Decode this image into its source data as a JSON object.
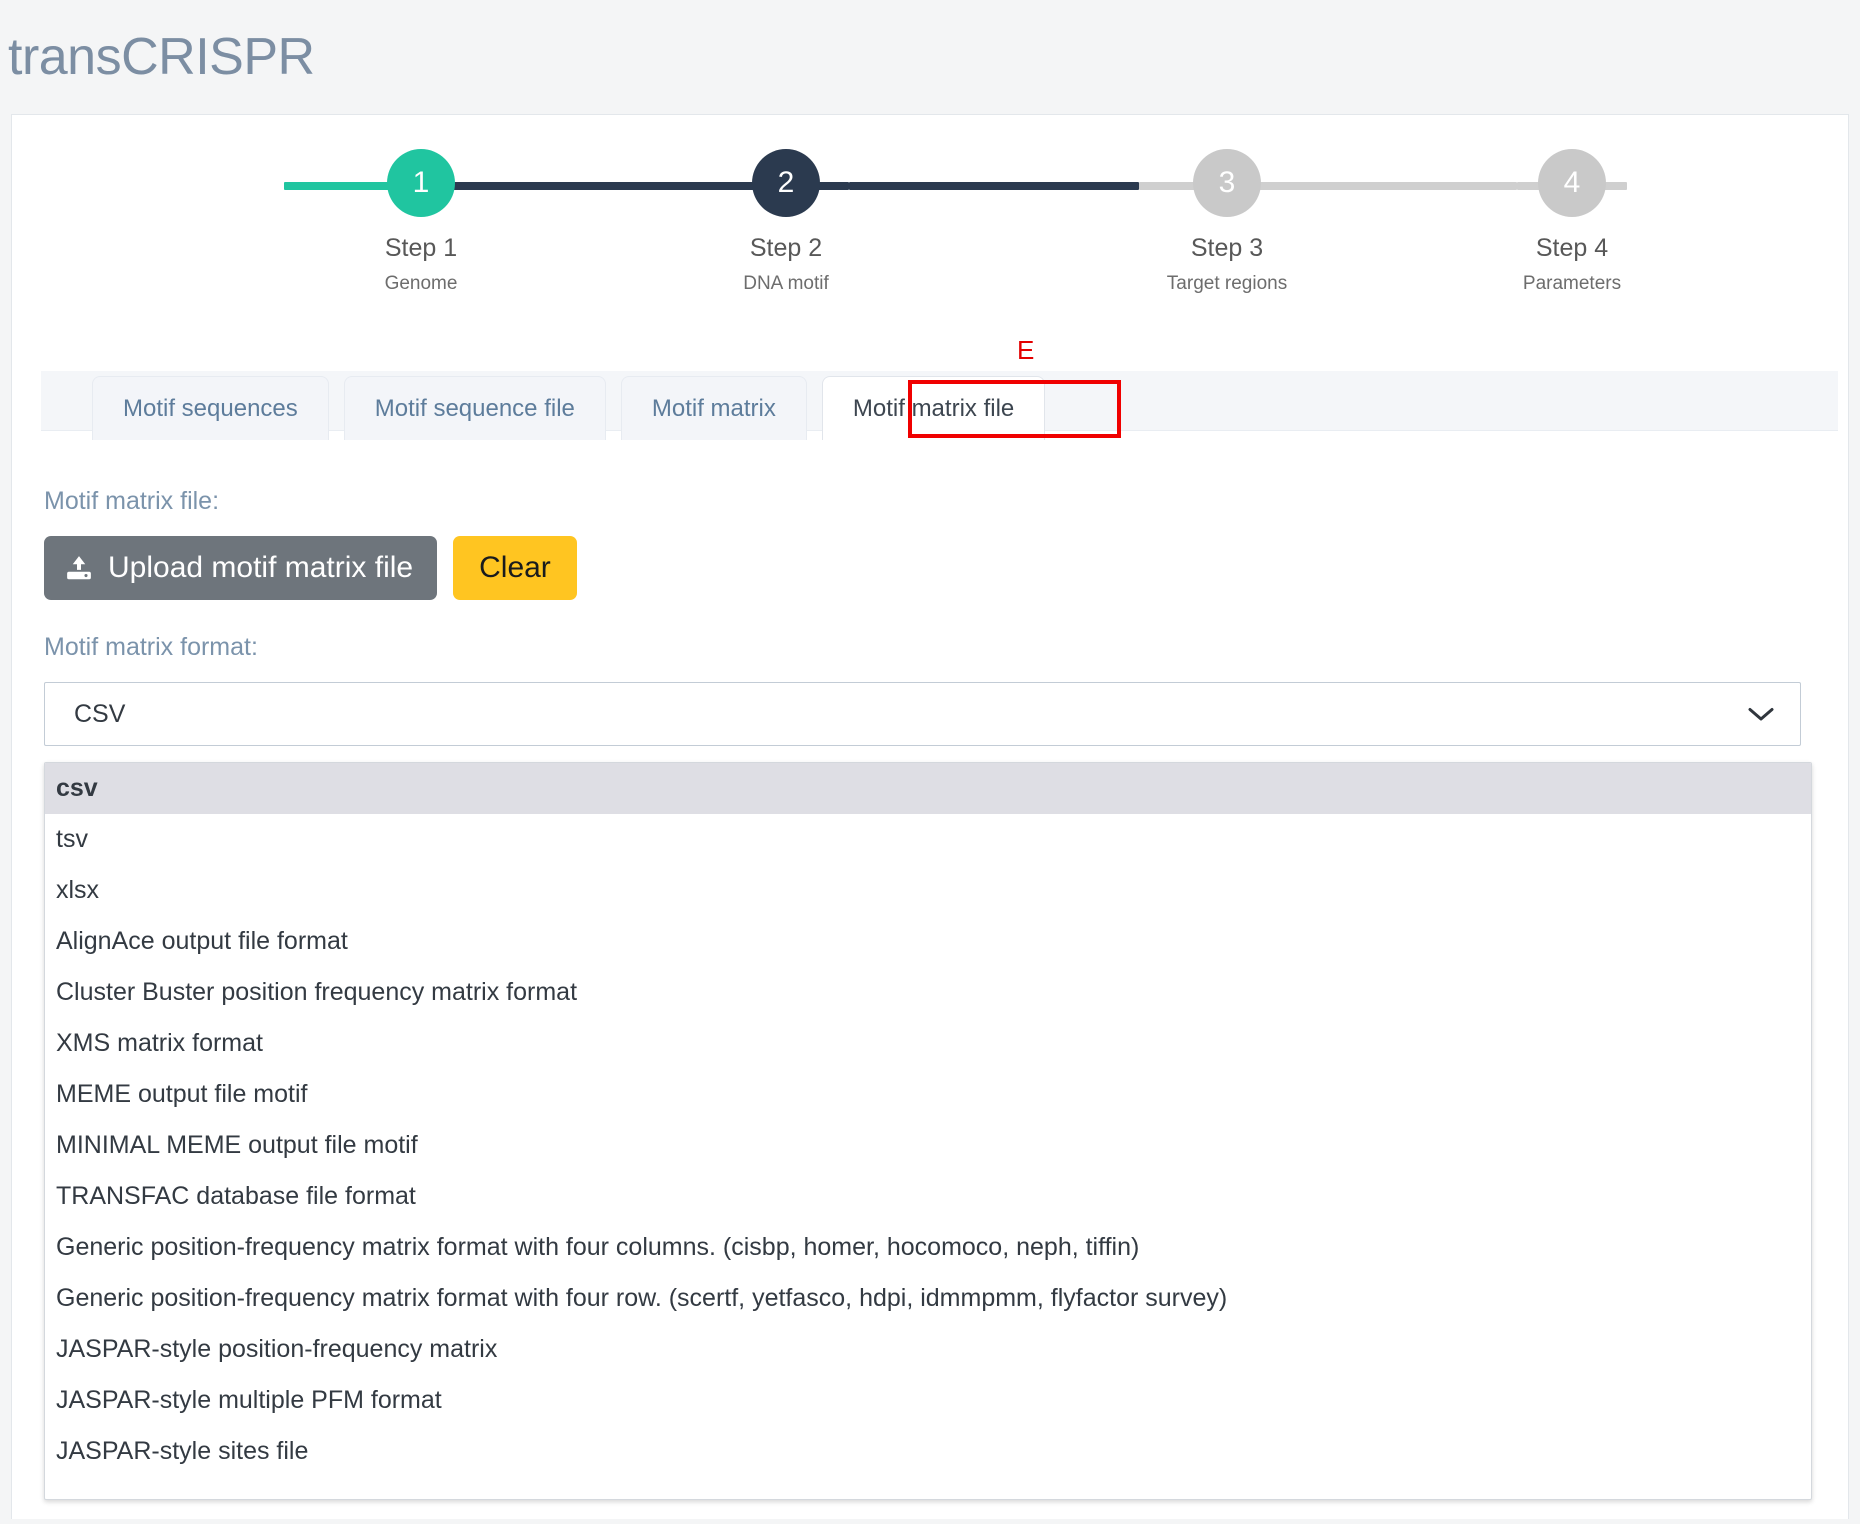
{
  "header": {
    "title": "transCRISPR"
  },
  "stepper": {
    "steps": [
      {
        "number": "1",
        "name": "Step 1",
        "sub": "Genome",
        "state": "done"
      },
      {
        "number": "2",
        "name": "Step 2",
        "sub": "DNA motif",
        "state": "active"
      },
      {
        "number": "3",
        "name": "Step 3",
        "sub": "Target regions",
        "state": "todo"
      },
      {
        "number": "4",
        "name": "Step 4",
        "sub": "Parameters",
        "state": "todo"
      }
    ],
    "colors": {
      "done": "#20c5a0",
      "active": "#2b3a4f",
      "todo": "#c9c9c9"
    }
  },
  "tabs": {
    "items": [
      {
        "label": "Motif sequences",
        "active": false
      },
      {
        "label": "Motif sequence file",
        "active": false
      },
      {
        "label": "Motif matrix",
        "active": false
      },
      {
        "label": "Motif matrix file",
        "active": true
      }
    ],
    "annotation": {
      "letter": "E",
      "color": "#e30000",
      "target": "Motif matrix file"
    }
  },
  "form": {
    "file_label": "Motif matrix file:",
    "upload_button": "Upload motif matrix file",
    "clear_button": "Clear",
    "format_label": "Motif matrix format:",
    "format_selected": "CSV",
    "format_options": [
      "csv",
      "tsv",
      "xlsx",
      "AlignAce output file format",
      "Cluster Buster position frequency matrix format",
      "XMS matrix format",
      "MEME output file motif",
      "MINIMAL MEME output file motif",
      "TRANSFAC database file format",
      "Generic position-frequency matrix format with four columns. (cisbp, homer, hocomoco, neph, tiffin)",
      "Generic position-frequency matrix format with four row. (scertf, yetfasco, hdpi, idmmpmm, flyfactor survey)",
      "JASPAR-style position-frequency matrix",
      "JASPAR-style multiple PFM format",
      "JASPAR-style sites file"
    ],
    "format_selected_index": 0
  },
  "colors": {
    "accent_teal": "#20c5a0",
    "accent_navy": "#2b3a4f",
    "upload_grey": "#6e757c",
    "clear_amber": "#ffc521",
    "label_blue": "#7b93ab",
    "annotation_red": "#e30000"
  }
}
